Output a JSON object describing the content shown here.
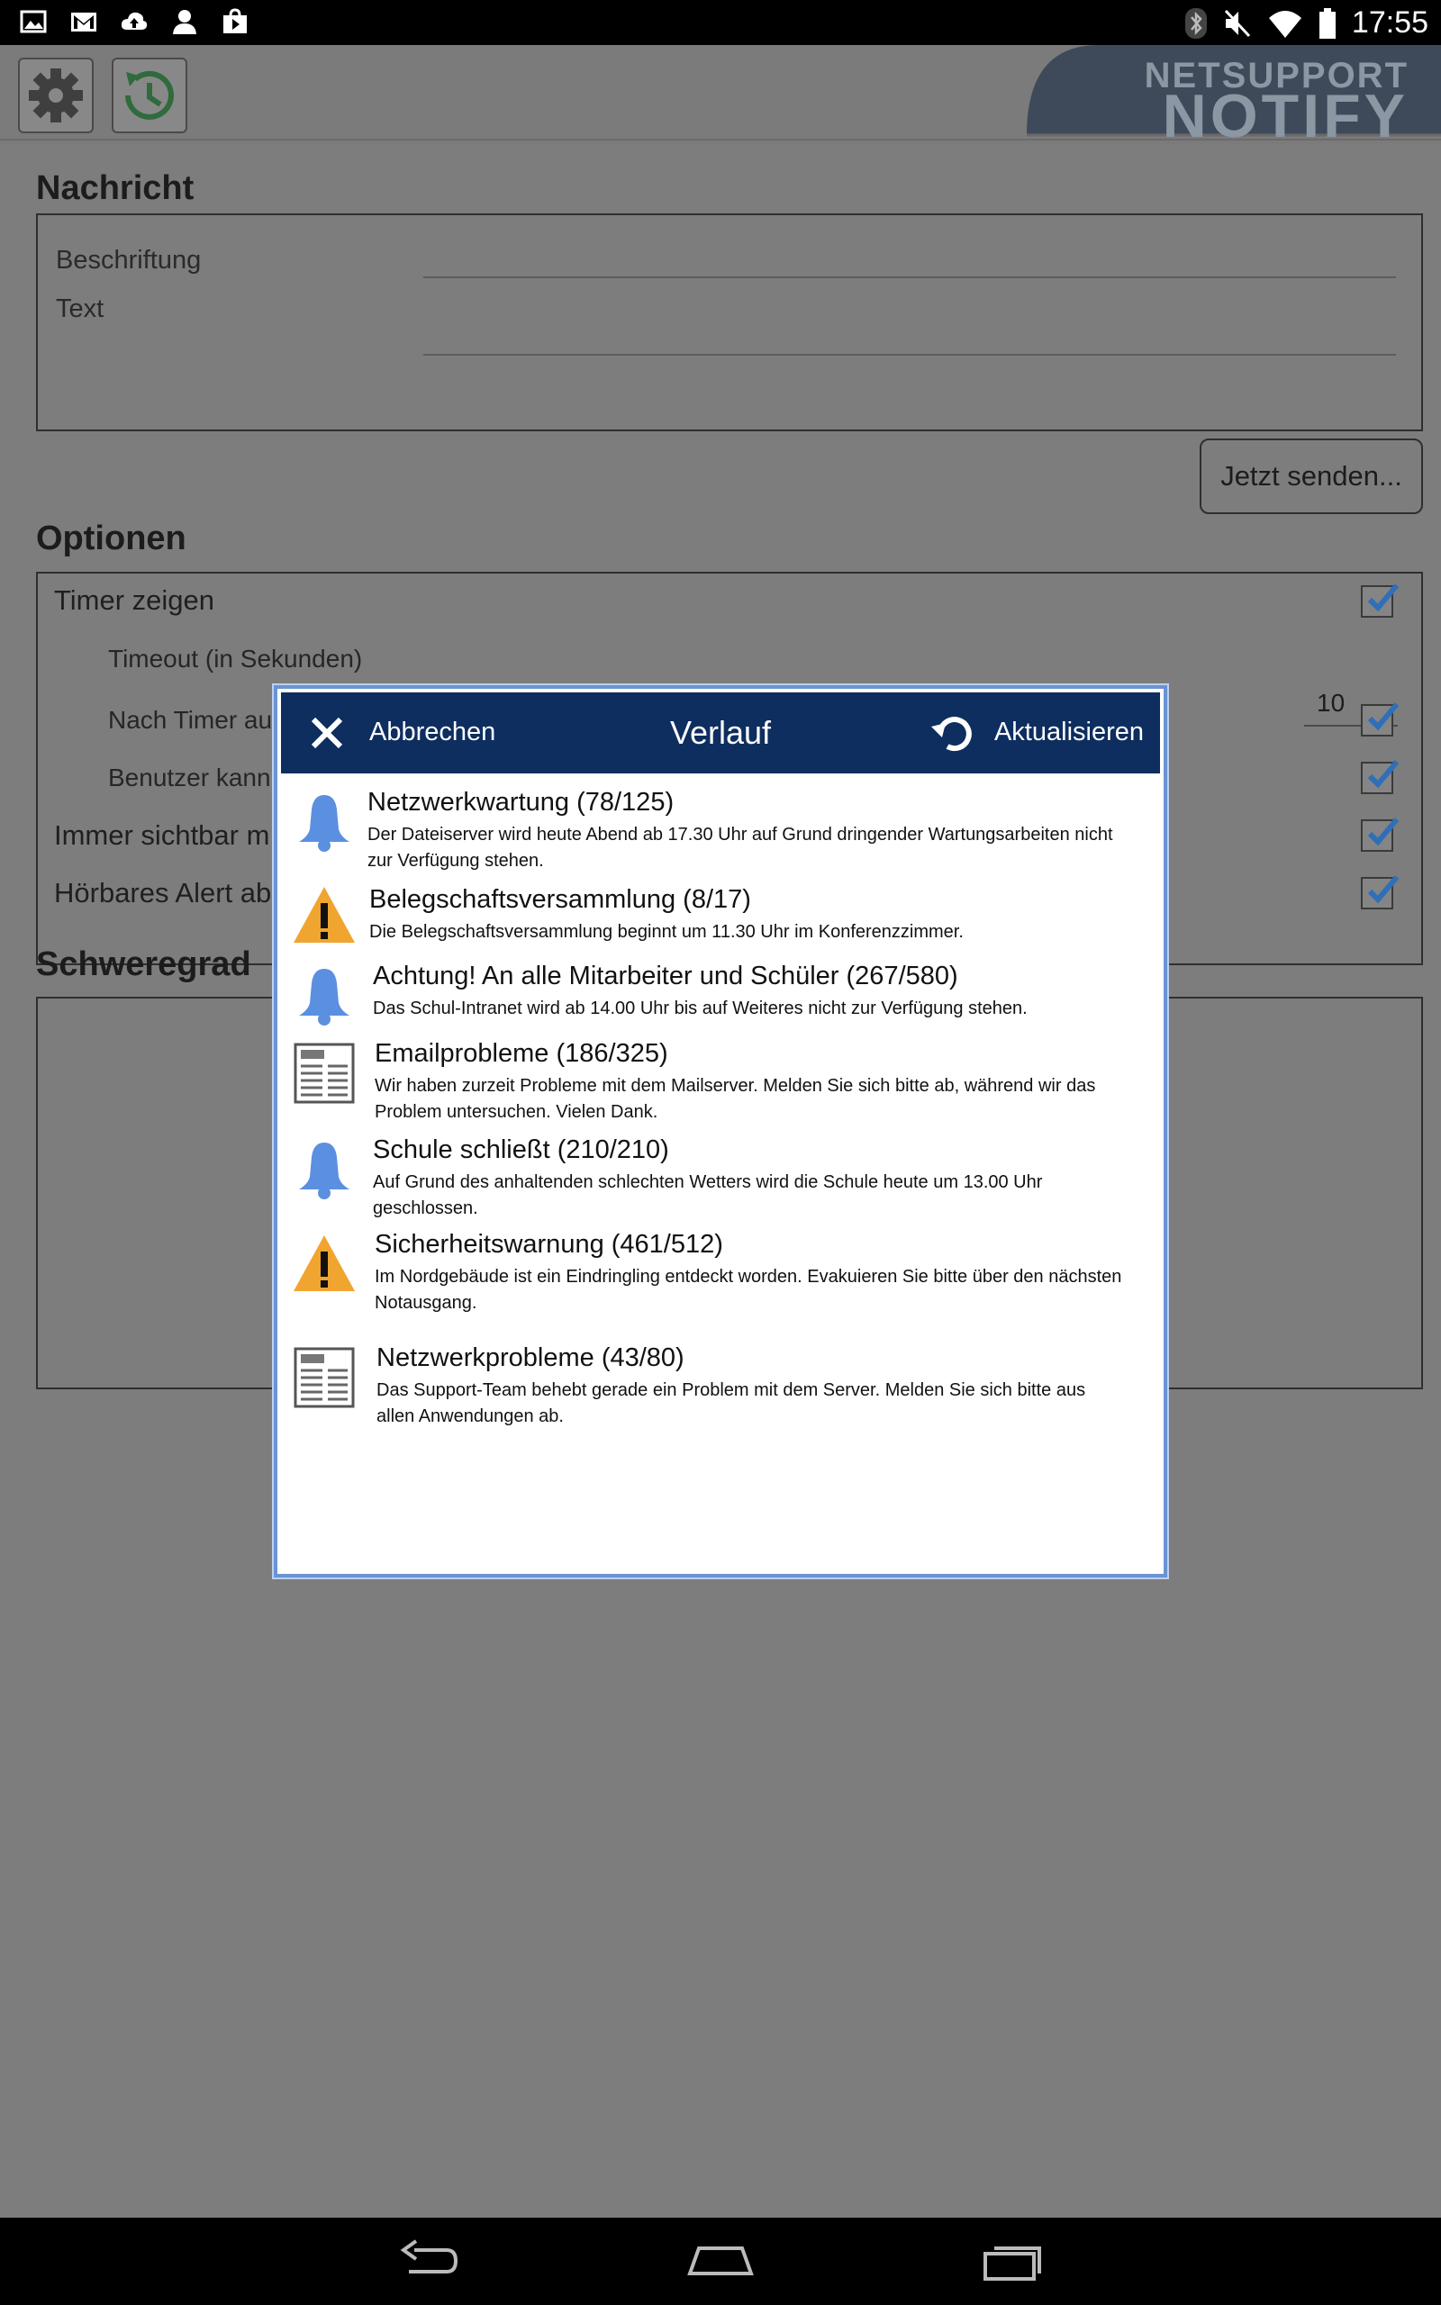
{
  "status_bar": {
    "left_icons": [
      "image-icon",
      "gmail-icon",
      "cloud-upload-icon",
      "person-icon",
      "shopping-bag-icon"
    ],
    "right_icons": [
      "bluetooth-icon",
      "mute-icon",
      "wifi-icon",
      "battery-icon"
    ],
    "time": "17:55"
  },
  "app": {
    "brand_line1": "NETSUPPORT",
    "brand_line2": "NOTIFY",
    "settings_icon": "gear-icon",
    "history_icon": "history-clock-icon"
  },
  "message": {
    "section_title": "Nachricht",
    "caption_label": "Beschriftung",
    "caption_value": "",
    "text_label": "Text",
    "text_value": "",
    "send_label": "Jetzt senden..."
  },
  "options": {
    "section_title": "Optionen",
    "show_timer_label": "Timer zeigen",
    "show_timer_checked": true,
    "timeout_label": "Timeout (in Sekunden)",
    "timeout_value": "10",
    "after_timer_label": "Nach Timer au",
    "after_timer_checked": true,
    "user_can_label": "Benutzer kann",
    "user_can_checked": true,
    "always_visible_label": "Immer sichtbar m",
    "always_visible_checked": true,
    "audible_alert_label": "Hörbares Alert ab",
    "audible_alert_checked": true
  },
  "severity": {
    "section_title": "Schweregrad"
  },
  "dialog": {
    "cancel_label": "Abbrechen",
    "title": "Verlauf",
    "refresh_label": "Aktualisieren",
    "items": [
      {
        "icon": "bell-icon",
        "title": "Netzwerkwartung (78/125)",
        "text": "Der Dateiserver wird heute Abend ab 17.30 Uhr auf Grund dringender Wartungsarbeiten nicht zur Verfügung stehen."
      },
      {
        "icon": "warning-icon",
        "title": "Belegschaftsversammlung (8/17)",
        "text": "Die Belegschaftsversammlung beginnt um 11.30 Uhr im Konferenzzimmer."
      },
      {
        "icon": "bell-icon",
        "title": "Achtung! An alle Mitarbeiter und Schüler (267/580)",
        "text": "Das Schul-Intranet wird ab 14.00 Uhr bis auf Weiteres nicht zur Verfügung stehen."
      },
      {
        "icon": "news-icon",
        "title": "Emailprobleme (186/325)",
        "text": "Wir haben zurzeit Probleme mit dem Mailserver. Melden Sie sich bitte ab, während wir das Problem untersuchen. Vielen Dank."
      },
      {
        "icon": "bell-icon",
        "title": "Schule schließt (210/210)",
        "text": "Auf Grund des anhaltenden schlechten Wetters wird die Schule heute um 13.00 Uhr geschlossen."
      },
      {
        "icon": "warning-icon",
        "title": "Sicherheitswarnung (461/512)",
        "text": "Im Nordgebäude ist ein Eindringling entdeckt worden. Evakuieren Sie bitte über den nächsten Notausgang."
      },
      {
        "icon": "news-icon",
        "title": "Netzwerkprobleme (43/80)",
        "text": "Das Support-Team behebt gerade ein Problem mit dem Server. Melden Sie sich bitte aus allen Anwendungen ab."
      }
    ]
  },
  "nav_bar": {
    "icons": [
      "back-icon",
      "home-icon",
      "recents-icon"
    ]
  }
}
